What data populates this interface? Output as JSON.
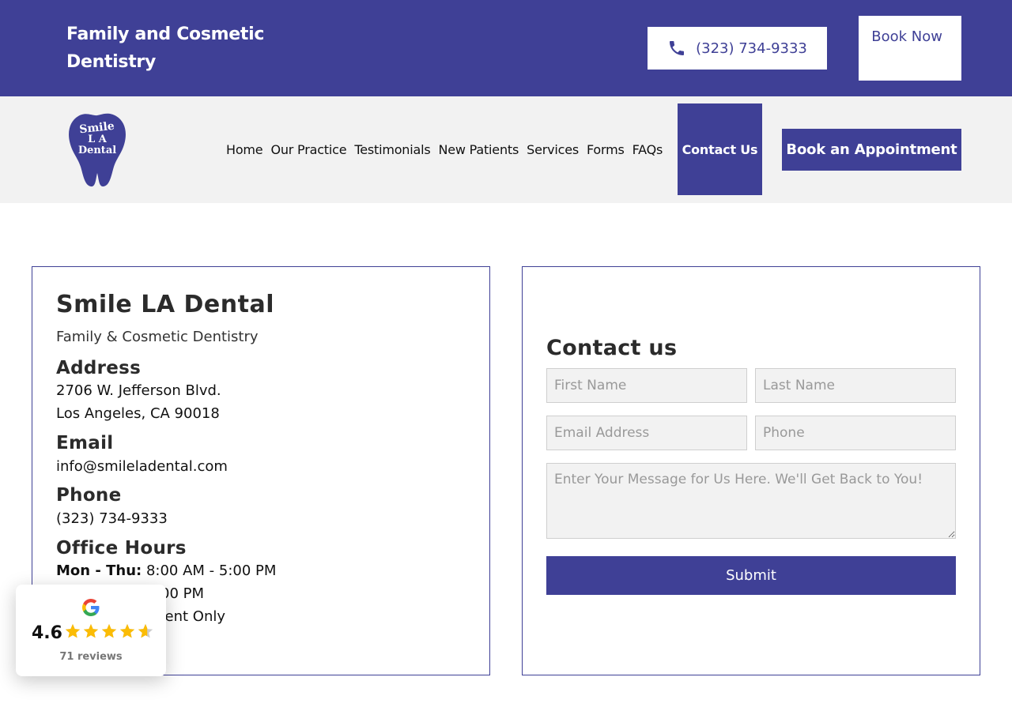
{
  "header": {
    "tagline": "Family and Cosmetic Dentistry",
    "phone": "(323) 734-9333",
    "book_now": "Book Now"
  },
  "nav": {
    "logo_lines": [
      "Smile",
      "L A",
      "Dental"
    ],
    "items": [
      "Home",
      "Our Practice",
      "Testimonials",
      "New Patients",
      "Services",
      "Forms",
      "FAQs"
    ],
    "active": "Contact Us",
    "cta": "Book an Appointment"
  },
  "info": {
    "name": "Smile LA Dental",
    "subtitle": "Family & Cosmetic Dentistry",
    "address_heading": "Address",
    "address_line1": "2706 W. Jefferson Blvd.",
    "address_line2": "Los Angeles, CA 90018",
    "email_heading": "Email",
    "email": "info@smileladental.com",
    "phone_heading": "Phone",
    "phone": "(323) 734-9333",
    "hours_heading": "Office Hours",
    "hours_days": "Mon - Thu:",
    "hours_time": "8:00 AM - 5:00 PM",
    "hours_line2": "00 PM",
    "hours_line3": "ment Only"
  },
  "form": {
    "title": "Contact us",
    "first_name": "First Name",
    "last_name": "Last Name",
    "email": "Email Address",
    "phone": "Phone",
    "message": "Enter Your Message for Us Here. We'll Get Back to You!",
    "submit": "Submit"
  },
  "review": {
    "rating": "4.6",
    "stars": 4.6,
    "count": "71 reviews"
  },
  "colors": {
    "brand": "#3f4096",
    "star": "#fbbc05"
  }
}
